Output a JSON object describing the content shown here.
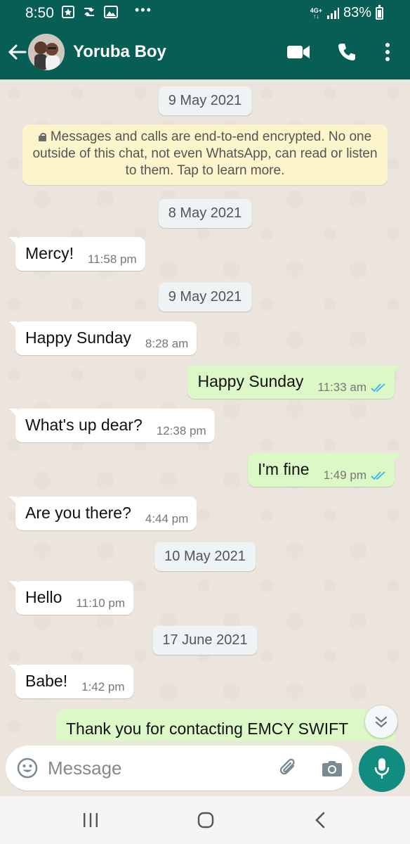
{
  "status_bar": {
    "time": "8:50",
    "network": "4G+",
    "battery": "83%"
  },
  "header": {
    "contact_name": "Yoruba Boy"
  },
  "chat": {
    "encryption_notice": "Messages and calls are end-to-end encrypted. No one outside of this chat, not even WhatsApp, can read or listen to them. Tap to learn more.",
    "dates": [
      "9 May 2021",
      "8 May 2021",
      "9 May 2021",
      "10 May 2021",
      "17 June 2021"
    ],
    "messages": [
      {
        "direction": "in",
        "text": "Mercy!",
        "time": "11:58 pm"
      },
      {
        "direction": "in",
        "text": "Happy Sunday",
        "time": "8:28 am"
      },
      {
        "direction": "out",
        "text": "Happy Sunday",
        "time": "11:33 am",
        "status": "read"
      },
      {
        "direction": "in",
        "text": "What's up dear?",
        "time": "12:38 pm"
      },
      {
        "direction": "out",
        "text": "I'm fine",
        "time": "1:49 pm",
        "status": "read"
      },
      {
        "direction": "in",
        "text": "Are you there?",
        "time": "4:44 pm"
      },
      {
        "direction": "in",
        "text": "Hello",
        "time": "11:10 pm"
      },
      {
        "direction": "in",
        "text": "Babe!",
        "time": "1:42 pm"
      }
    ],
    "partial_message": "Thank you for contacting EMCY SWIFT"
  },
  "composer": {
    "placeholder": "Message"
  },
  "colors": {
    "header": "#075e54",
    "outgoing_bubble": "#dcf8c6",
    "incoming_bubble": "#ffffff",
    "read_ticks": "#34b7f1",
    "mic_button": "#128c7e"
  },
  "icons": [
    "back-arrow-icon",
    "video-call-icon",
    "phone-icon",
    "more-vert-icon",
    "lock-icon",
    "double-check-icon",
    "chevron-double-down-icon",
    "emoji-icon",
    "paperclip-icon",
    "camera-icon",
    "mic-icon",
    "recents-icon",
    "home-icon",
    "back-nav-icon"
  ]
}
